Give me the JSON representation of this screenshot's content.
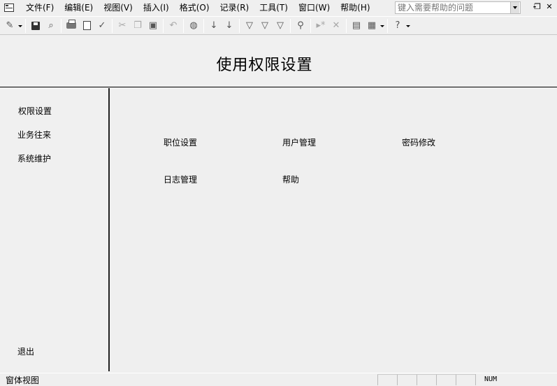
{
  "menu": {
    "items": [
      "文件(F)",
      "编辑(E)",
      "视图(V)",
      "插入(I)",
      "格式(O)",
      "记录(R)",
      "工具(T)",
      "窗口(W)",
      "帮助(H)"
    ],
    "help_placeholder": "键入需要帮助的问题"
  },
  "page": {
    "title": "使用权限设置"
  },
  "sidebar": {
    "items": [
      "权限设置",
      "业务往来",
      "系统维护"
    ],
    "exit_label": "退出"
  },
  "main": {
    "links": [
      "职位设置",
      "用户管理",
      "密码修改",
      "日志管理",
      "帮助"
    ]
  },
  "status": {
    "text": "窗体视图",
    "num": "NUM"
  }
}
